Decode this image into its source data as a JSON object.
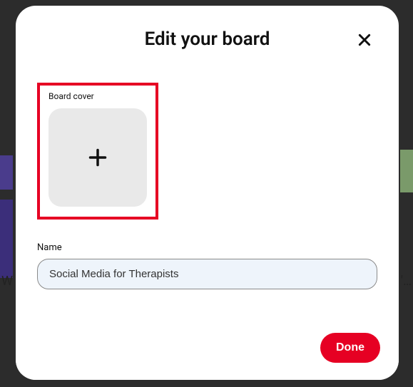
{
  "modal": {
    "title": "Edit your board",
    "close_label": "Close"
  },
  "cover": {
    "label": "Board cover",
    "add_label": "Add cover"
  },
  "name": {
    "label": "Name",
    "value": "Social Media for Therapists"
  },
  "footer": {
    "done_label": "Done"
  },
  "background": {
    "left_text": "W",
    "right_text": "'…"
  },
  "colors": {
    "accent": "#e60023"
  }
}
